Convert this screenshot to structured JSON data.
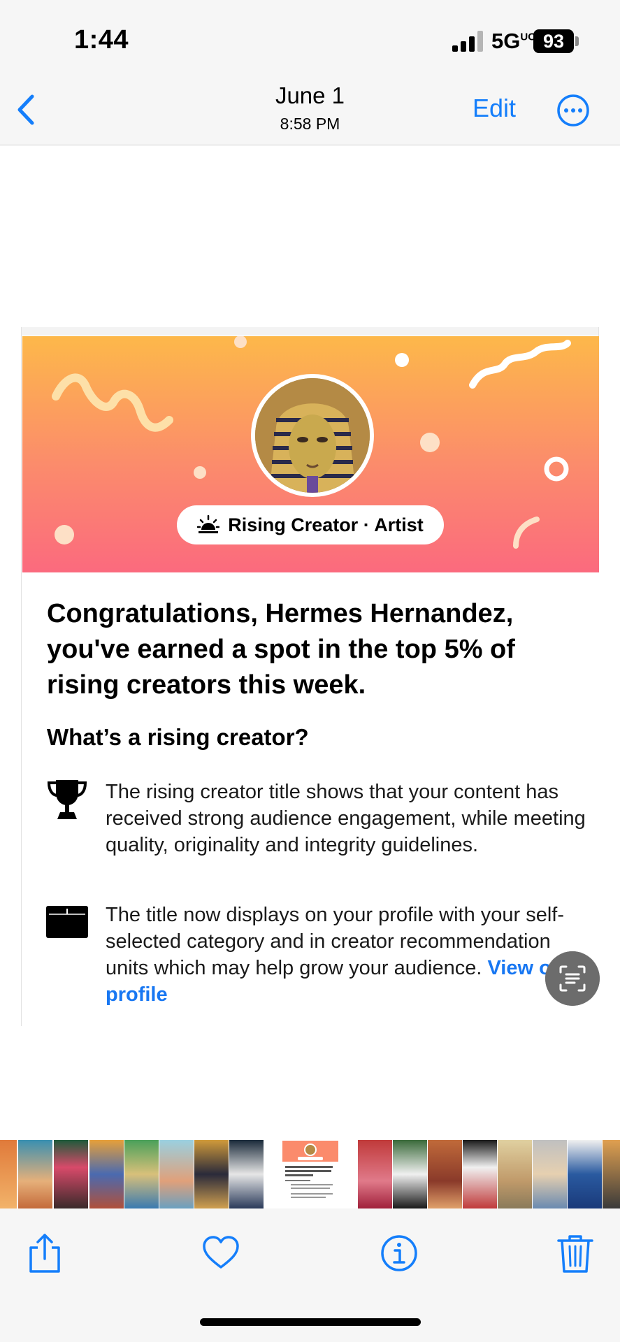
{
  "status_bar": {
    "time": "1:44",
    "network": "5G",
    "network_suffix": "UC",
    "battery": "93"
  },
  "nav": {
    "date": "June 1",
    "time": "8:58 PM",
    "edit_label": "Edit",
    "back_icon": "chevron-left-icon",
    "more_icon": "ellipsis-circle-icon"
  },
  "card": {
    "badge_label": "Rising Creator · Artist",
    "badge_icon": "sunrise-icon",
    "headline": "Congratulations, Hermes Hernandez, you've earned a spot in the top 5% of rising creators this week.",
    "subheading": "What’s a rising creator?",
    "item1_text": "The rising creator title shows that your content has received strong audience engagement, while meeting quality, originality and integrity guidelines.",
    "item2_text": "The title now displays on your profile with your self-selected category and in creator recommendation units which may help grow your audience.",
    "item2_link": "View on profile"
  },
  "colors": {
    "accent": "#147efb",
    "link": "#1877f2",
    "banner_top": "#fdb84a",
    "banner_bottom": "#fb6a7e"
  },
  "toolbar": {
    "icons": [
      "share-icon",
      "heart-icon",
      "info-icon",
      "trash-icon"
    ]
  }
}
